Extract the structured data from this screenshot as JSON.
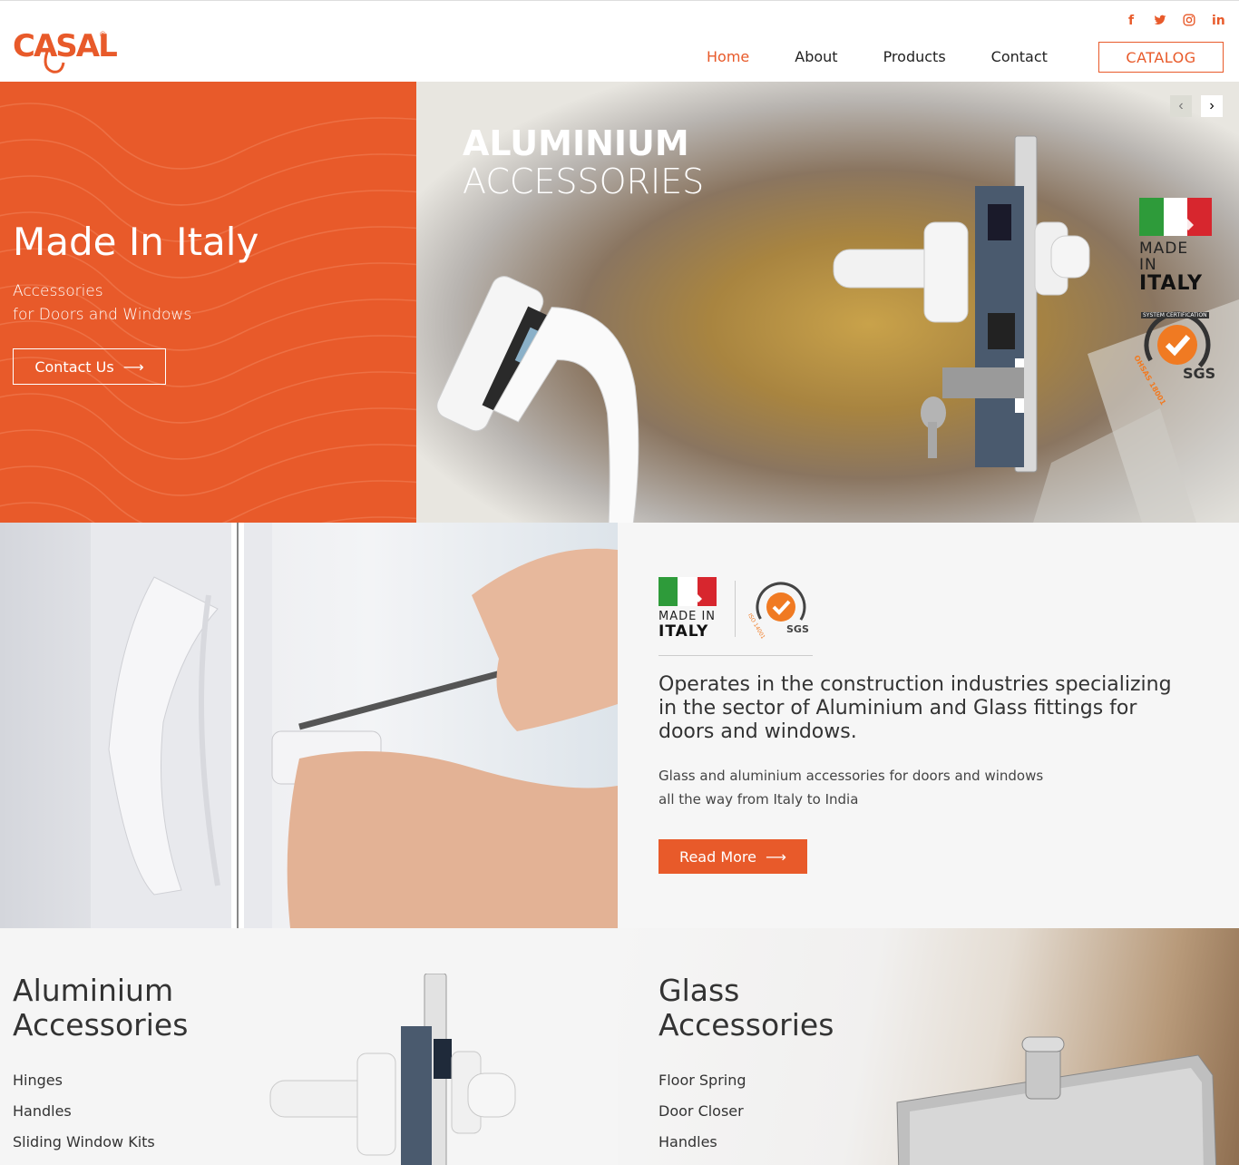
{
  "brand": {
    "logo_text": "CASAL",
    "accent": "#e85a2a"
  },
  "social": [
    {
      "name": "facebook",
      "glyph": "f"
    },
    {
      "name": "twitter",
      "glyph": "t"
    },
    {
      "name": "instagram",
      "glyph": "◎"
    },
    {
      "name": "linkedin",
      "glyph": "in"
    }
  ],
  "nav": {
    "items": [
      {
        "label": "Home",
        "active": true
      },
      {
        "label": "About"
      },
      {
        "label": "Products"
      },
      {
        "label": "Contact"
      }
    ],
    "catalog_label": "CATALOG"
  },
  "hero": {
    "title": "Made In Italy",
    "sub_line1": "Accessories",
    "sub_line2": "for Doors and Windows",
    "cta_label": "Contact Us",
    "slide_title_bold": "ALUMINIUM",
    "slide_title_light": "ACCESSORIES",
    "badge_made_in": "MADE IN",
    "badge_italy": "ITALY",
    "sgs_label": "SGS",
    "sgs_ring": "SYSTEM CERTIFICATION",
    "sgs_sub": "OHSAS 18001"
  },
  "about": {
    "badge_made_in": "MADE IN",
    "badge_italy": "ITALY",
    "sgs_label": "SGS",
    "sgs_sub": "ISO 14001",
    "headline": "Operates in the construction industries specializing in the sector of Aluminium and Glass fittings for doors and windows.",
    "text_line1": "Glass and aluminium accessories for doors and windows",
    "text_line2": "all the way from Italy to India",
    "read_more": "Read More"
  },
  "categories": [
    {
      "title_line1": "Aluminium",
      "title_line2": "Accessories",
      "items": [
        "Hinges",
        "Handles",
        "Sliding Window Kits"
      ]
    },
    {
      "title_line1": "Glass",
      "title_line2": "Accessories",
      "items": [
        "Floor Spring",
        "Door Closer",
        "Handles"
      ]
    }
  ]
}
